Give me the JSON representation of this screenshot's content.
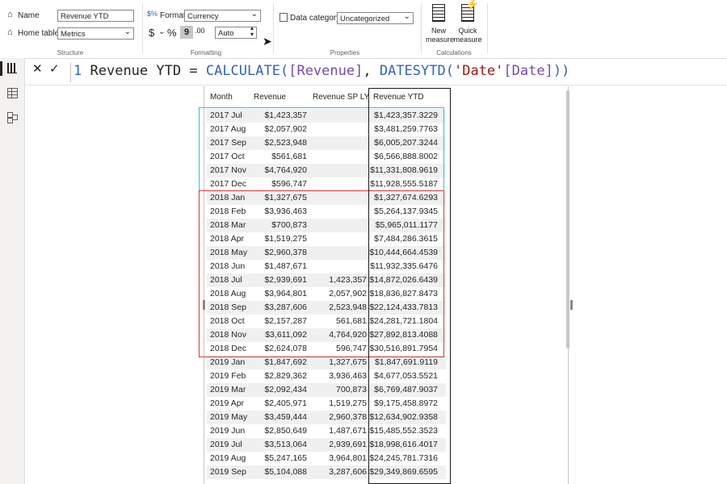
{
  "ribbon": {
    "structure": {
      "name_label": "Name",
      "name_value": "Revenue YTD",
      "home_table_label": "Home table",
      "home_table_value": "Metrics",
      "group_label": "Structure"
    },
    "formatting": {
      "format_label": "Format",
      "format_value": "Currency",
      "currency_symbol": "$",
      "percent_symbol": "%",
      "comma_symbol": "9",
      "decimal_symbol": ".00",
      "decimal_value": "Auto",
      "group_label": "Formatting"
    },
    "properties": {
      "data_category_label": "Data category",
      "data_category_value": "Uncategorized",
      "group_label": "Properties"
    },
    "calculations": {
      "new_measure_line1": "New",
      "new_measure_line2": "measure",
      "quick_measure_line1": "Quick",
      "quick_measure_line2": "measure",
      "group_label": "Calculations"
    }
  },
  "formula_bar": {
    "cancel": "✕",
    "commit": "✓",
    "line_number": "1",
    "measure_name": "Revenue YTD",
    "equals": "=",
    "func1": "CALCULATE",
    "open1": "(",
    "arg1": "[Revenue]",
    "comma": ",",
    "func2": "DATESYTD",
    "open2": "(",
    "arg2_table": "'Date'",
    "arg2_col": "[Date]",
    "close": "))"
  },
  "table": {
    "headers": [
      "Month",
      "Revenue",
      "Revenue SP LY",
      "Revenue YTD"
    ],
    "rows": [
      [
        "2017 Jul",
        "$1,423,357",
        "",
        "$1,423,357.3229"
      ],
      [
        "2017 Aug",
        "$2,057,902",
        "",
        "$3,481,259.7763"
      ],
      [
        "2017 Sep",
        "$2,523,948",
        "",
        "$6,005,207.3244"
      ],
      [
        "2017 Oct",
        "$561,681",
        "",
        "$6,566,888.8002"
      ],
      [
        "2017 Nov",
        "$4,764,920",
        "",
        "$11,331,808.9619"
      ],
      [
        "2017 Dec",
        "$596,747",
        "",
        "$11,928,555.5187"
      ],
      [
        "2018 Jan",
        "$1,327,675",
        "",
        "$1,327,674.6293"
      ],
      [
        "2018 Feb",
        "$3,936,463",
        "",
        "$5,264,137.9345"
      ],
      [
        "2018 Mar",
        "$700,873",
        "",
        "$5,965,011.1177"
      ],
      [
        "2018 Apr",
        "$1,519,275",
        "",
        "$7,484,286.3615"
      ],
      [
        "2018 May",
        "$2,960,378",
        "",
        "$10,444,664.4539"
      ],
      [
        "2018 Jun",
        "$1,487,671",
        "",
        "$11,932,335.6476"
      ],
      [
        "2018 Jul",
        "$2,939,691",
        "1,423,357",
        "$14,872,026.6439"
      ],
      [
        "2018 Aug",
        "$3,964,801",
        "2,057,902",
        "$18,836,827.8473"
      ],
      [
        "2018 Sep",
        "$3,287,606",
        "2,523,948",
        "$22,124,433.7813"
      ],
      [
        "2018 Oct",
        "$2,157,287",
        "561,681",
        "$24,281,721.1804"
      ],
      [
        "2018 Nov",
        "$3,611,092",
        "4,764,920",
        "$27,892,813.4088"
      ],
      [
        "2018 Dec",
        "$2,624,078",
        "596,747",
        "$30,516,891.7954"
      ],
      [
        "2019 Jan",
        "$1,847,692",
        "1,327,675",
        "$1,847,691.9119"
      ],
      [
        "2019 Feb",
        "$2,829,362",
        "3,936,463",
        "$4,677,053.5521"
      ],
      [
        "2019 Mar",
        "$2,092,434",
        "700,873",
        "$6,769,487.9037"
      ],
      [
        "2019 Apr",
        "$2,405,971",
        "1,519,275",
        "$9,175,458.8972"
      ],
      [
        "2019 May",
        "$3,459,444",
        "2,960,378",
        "$12,634,902.9358"
      ],
      [
        "2019 Jun",
        "$2,850,649",
        "1,487,671",
        "$15,485,552.3523"
      ],
      [
        "2019 Jul",
        "$3,513,064",
        "2,939,691",
        "$18,998,616.4017"
      ],
      [
        "2019 Aug",
        "$5,247,165",
        "3,964,801",
        "$24,245,781.7316"
      ],
      [
        "2019 Sep",
        "$5,104,088",
        "3,287,606",
        "$29,349,869.6595"
      ]
    ]
  },
  "colors": {
    "highlight_2017": "#35c3d3",
    "highlight_2018": "#d9383a",
    "column_outline": "#1a1a1a",
    "keyword": "#3165bb",
    "reference": "#754aa9",
    "string": "#a31515"
  }
}
